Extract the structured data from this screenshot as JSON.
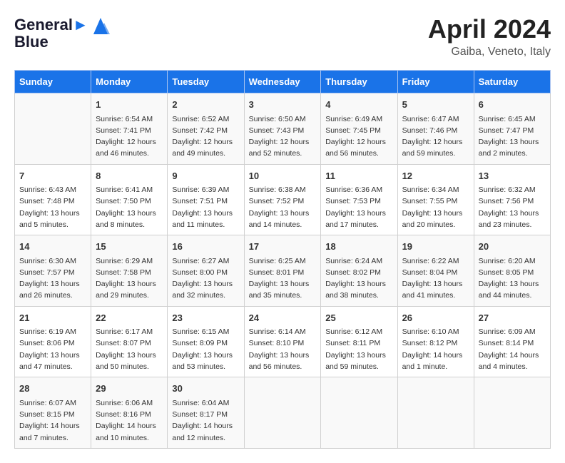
{
  "header": {
    "logo_line1": "General",
    "logo_line2": "Blue",
    "month_title": "April 2024",
    "location": "Gaiba, Veneto, Italy"
  },
  "weekdays": [
    "Sunday",
    "Monday",
    "Tuesday",
    "Wednesday",
    "Thursday",
    "Friday",
    "Saturday"
  ],
  "weeks": [
    [
      {
        "day": "",
        "info": ""
      },
      {
        "day": "1",
        "info": "Sunrise: 6:54 AM\nSunset: 7:41 PM\nDaylight: 12 hours\nand 46 minutes."
      },
      {
        "day": "2",
        "info": "Sunrise: 6:52 AM\nSunset: 7:42 PM\nDaylight: 12 hours\nand 49 minutes."
      },
      {
        "day": "3",
        "info": "Sunrise: 6:50 AM\nSunset: 7:43 PM\nDaylight: 12 hours\nand 52 minutes."
      },
      {
        "day": "4",
        "info": "Sunrise: 6:49 AM\nSunset: 7:45 PM\nDaylight: 12 hours\nand 56 minutes."
      },
      {
        "day": "5",
        "info": "Sunrise: 6:47 AM\nSunset: 7:46 PM\nDaylight: 12 hours\nand 59 minutes."
      },
      {
        "day": "6",
        "info": "Sunrise: 6:45 AM\nSunset: 7:47 PM\nDaylight: 13 hours\nand 2 minutes."
      }
    ],
    [
      {
        "day": "7",
        "info": "Sunrise: 6:43 AM\nSunset: 7:48 PM\nDaylight: 13 hours\nand 5 minutes."
      },
      {
        "day": "8",
        "info": "Sunrise: 6:41 AM\nSunset: 7:50 PM\nDaylight: 13 hours\nand 8 minutes."
      },
      {
        "day": "9",
        "info": "Sunrise: 6:39 AM\nSunset: 7:51 PM\nDaylight: 13 hours\nand 11 minutes."
      },
      {
        "day": "10",
        "info": "Sunrise: 6:38 AM\nSunset: 7:52 PM\nDaylight: 13 hours\nand 14 minutes."
      },
      {
        "day": "11",
        "info": "Sunrise: 6:36 AM\nSunset: 7:53 PM\nDaylight: 13 hours\nand 17 minutes."
      },
      {
        "day": "12",
        "info": "Sunrise: 6:34 AM\nSunset: 7:55 PM\nDaylight: 13 hours\nand 20 minutes."
      },
      {
        "day": "13",
        "info": "Sunrise: 6:32 AM\nSunset: 7:56 PM\nDaylight: 13 hours\nand 23 minutes."
      }
    ],
    [
      {
        "day": "14",
        "info": "Sunrise: 6:30 AM\nSunset: 7:57 PM\nDaylight: 13 hours\nand 26 minutes."
      },
      {
        "day": "15",
        "info": "Sunrise: 6:29 AM\nSunset: 7:58 PM\nDaylight: 13 hours\nand 29 minutes."
      },
      {
        "day": "16",
        "info": "Sunrise: 6:27 AM\nSunset: 8:00 PM\nDaylight: 13 hours\nand 32 minutes."
      },
      {
        "day": "17",
        "info": "Sunrise: 6:25 AM\nSunset: 8:01 PM\nDaylight: 13 hours\nand 35 minutes."
      },
      {
        "day": "18",
        "info": "Sunrise: 6:24 AM\nSunset: 8:02 PM\nDaylight: 13 hours\nand 38 minutes."
      },
      {
        "day": "19",
        "info": "Sunrise: 6:22 AM\nSunset: 8:04 PM\nDaylight: 13 hours\nand 41 minutes."
      },
      {
        "day": "20",
        "info": "Sunrise: 6:20 AM\nSunset: 8:05 PM\nDaylight: 13 hours\nand 44 minutes."
      }
    ],
    [
      {
        "day": "21",
        "info": "Sunrise: 6:19 AM\nSunset: 8:06 PM\nDaylight: 13 hours\nand 47 minutes."
      },
      {
        "day": "22",
        "info": "Sunrise: 6:17 AM\nSunset: 8:07 PM\nDaylight: 13 hours\nand 50 minutes."
      },
      {
        "day": "23",
        "info": "Sunrise: 6:15 AM\nSunset: 8:09 PM\nDaylight: 13 hours\nand 53 minutes."
      },
      {
        "day": "24",
        "info": "Sunrise: 6:14 AM\nSunset: 8:10 PM\nDaylight: 13 hours\nand 56 minutes."
      },
      {
        "day": "25",
        "info": "Sunrise: 6:12 AM\nSunset: 8:11 PM\nDaylight: 13 hours\nand 59 minutes."
      },
      {
        "day": "26",
        "info": "Sunrise: 6:10 AM\nSunset: 8:12 PM\nDaylight: 14 hours\nand 1 minute."
      },
      {
        "day": "27",
        "info": "Sunrise: 6:09 AM\nSunset: 8:14 PM\nDaylight: 14 hours\nand 4 minutes."
      }
    ],
    [
      {
        "day": "28",
        "info": "Sunrise: 6:07 AM\nSunset: 8:15 PM\nDaylight: 14 hours\nand 7 minutes."
      },
      {
        "day": "29",
        "info": "Sunrise: 6:06 AM\nSunset: 8:16 PM\nDaylight: 14 hours\nand 10 minutes."
      },
      {
        "day": "30",
        "info": "Sunrise: 6:04 AM\nSunset: 8:17 PM\nDaylight: 14 hours\nand 12 minutes."
      },
      {
        "day": "",
        "info": ""
      },
      {
        "day": "",
        "info": ""
      },
      {
        "day": "",
        "info": ""
      },
      {
        "day": "",
        "info": ""
      }
    ]
  ]
}
